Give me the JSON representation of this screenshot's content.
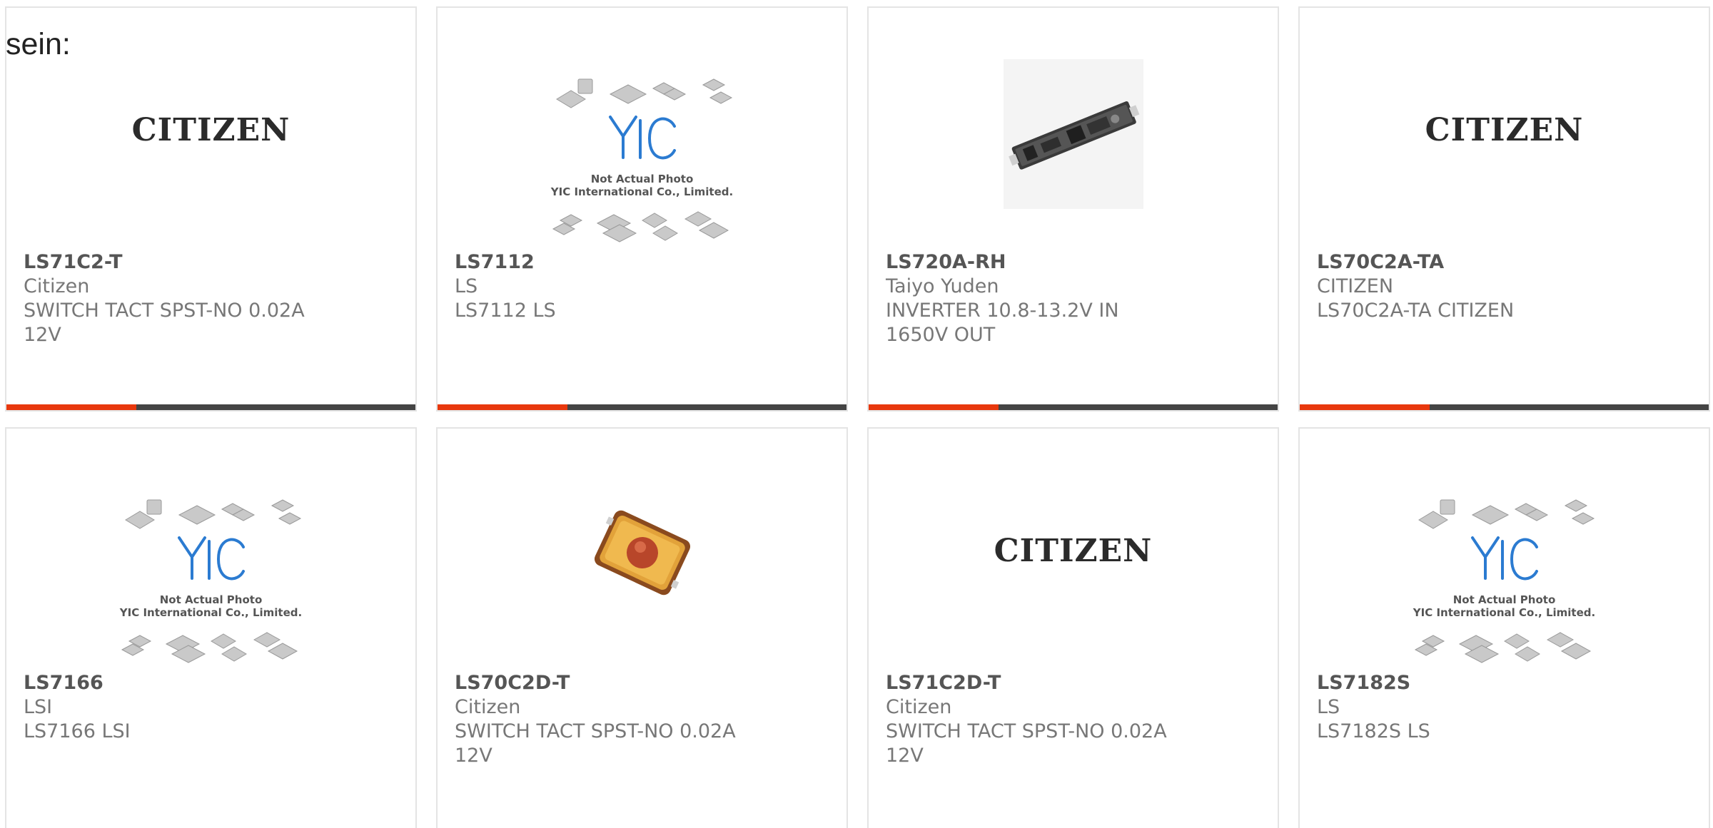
{
  "intro_text": "sein:",
  "yic_placeholder": {
    "line1": "Not Actual Photo",
    "line2": "YIC International Co., Limited."
  },
  "citizen_logo_text": "CITIZEN",
  "colors": {
    "accent": "#e8380d",
    "bar": "#444444",
    "yic_blue": "#2b7bd1"
  },
  "products": [
    {
      "part": "LS71C2-T",
      "maker": "Citizen",
      "desc": "SWITCH TACT SPST-NO 0.02A 12V",
      "image": "citizen-logo"
    },
    {
      "part": "LS7112",
      "maker": "LS",
      "desc": "LS7112 LS",
      "image": "yic-placeholder"
    },
    {
      "part": "LS720A-RH",
      "maker": "Taiyo Yuden",
      "desc": "INVERTER 10.8-13.2V IN 1650V OUT",
      "image": "inverter-board-photo"
    },
    {
      "part": "LS70C2A-TA",
      "maker": "CITIZEN",
      "desc": "LS70C2A-TA CITIZEN",
      "image": "citizen-logo"
    },
    {
      "part": "LS7166",
      "maker": "LSI",
      "desc": "LS7166 LSI",
      "image": "yic-placeholder"
    },
    {
      "part": "LS70C2D-T",
      "maker": "Citizen",
      "desc": "SWITCH TACT SPST-NO 0.02A 12V",
      "image": "tact-switch-photo"
    },
    {
      "part": "LS71C2D-T",
      "maker": "Citizen",
      "desc": "SWITCH TACT SPST-NO 0.02A 12V",
      "image": "citizen-logo"
    },
    {
      "part": "LS7182S",
      "maker": "LS",
      "desc": "LS7182S LS",
      "image": "yic-placeholder"
    }
  ]
}
